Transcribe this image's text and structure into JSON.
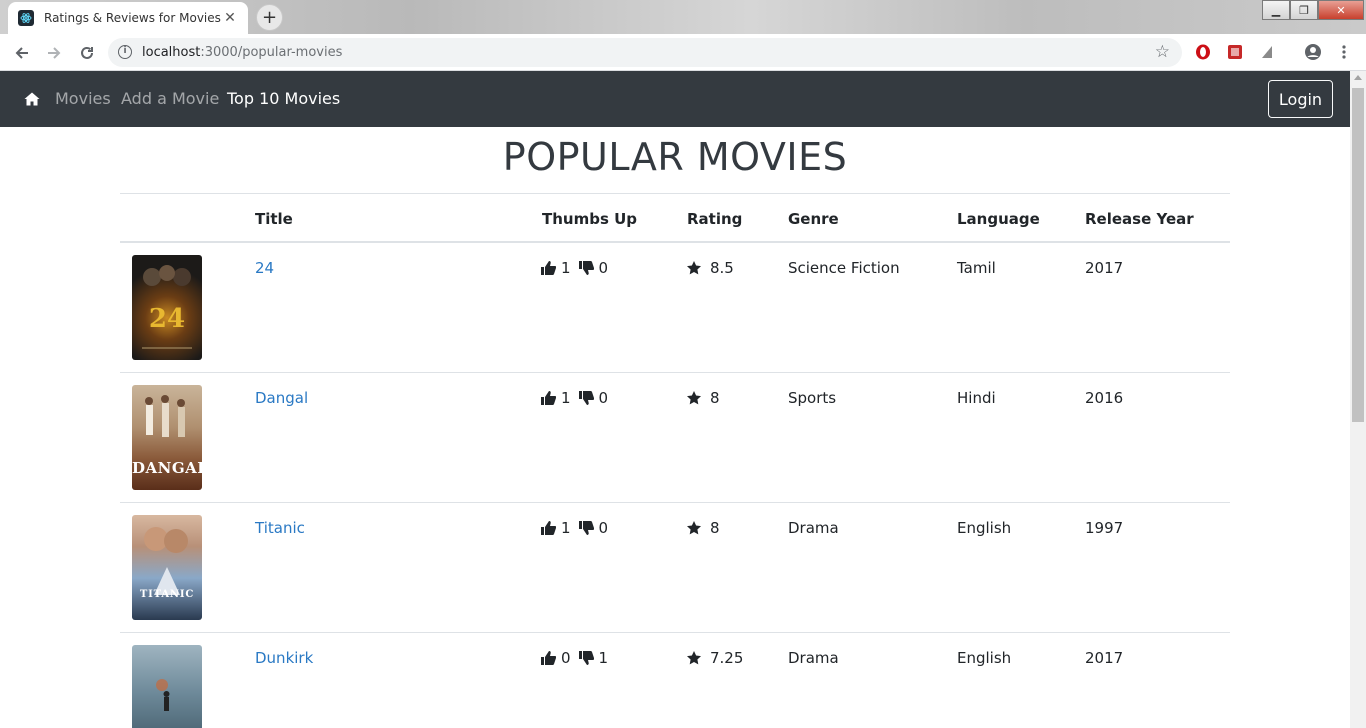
{
  "browser": {
    "tab_title": "Ratings & Reviews for Movies",
    "url_host": "localhost",
    "url_rest": ":3000/popular-movies"
  },
  "nav": {
    "links": [
      "Movies",
      "Add a Movie",
      "Top 10 Movies"
    ],
    "active": "Top 10 Movies",
    "login_label": "Login"
  },
  "page": {
    "title": "POPULAR MOVIES"
  },
  "table": {
    "headers": [
      "Title",
      "Thumbs Up",
      "Rating",
      "Genre",
      "Language",
      "Release Year"
    ],
    "rows": [
      {
        "title": "24",
        "up": "1",
        "down": "0",
        "rating": "8.5",
        "genre": "Science Fiction",
        "language": "Tamil",
        "year": "2017",
        "poster_text": ""
      },
      {
        "title": "Dangal",
        "up": "1",
        "down": "0",
        "rating": "8",
        "genre": "Sports",
        "language": "Hindi",
        "year": "2016",
        "poster_text": "DANGAL"
      },
      {
        "title": "Titanic",
        "up": "1",
        "down": "0",
        "rating": "8",
        "genre": "Drama",
        "language": "English",
        "year": "1997",
        "poster_text": "TITANIC"
      },
      {
        "title": "Dunkirk",
        "up": "0",
        "down": "1",
        "rating": "7.25",
        "genre": "Drama",
        "language": "English",
        "year": "2017",
        "poster_text": ""
      }
    ]
  },
  "colors": {
    "navbar": "#343a40",
    "link": "#2a79c4",
    "text": "#212529"
  },
  "icons": [
    "home-icon",
    "thumbs-up-icon",
    "thumbs-down-icon",
    "star-icon",
    "back-arrow-icon",
    "forward-arrow-icon",
    "reload-icon",
    "info-icon",
    "bookmark-star-icon",
    "profile-icon",
    "menu-dots-icon"
  ]
}
